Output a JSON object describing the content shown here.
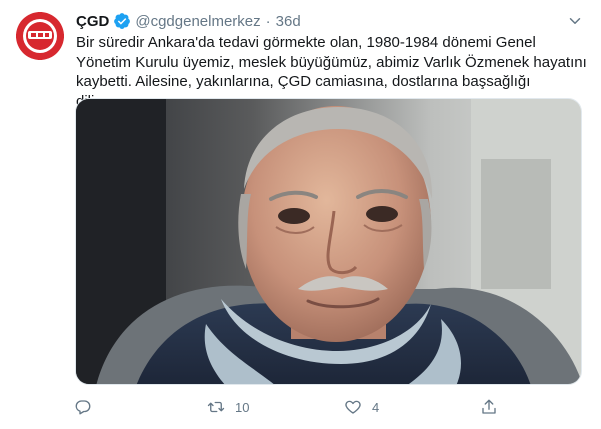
{
  "account": {
    "name": "ÇGD",
    "handle": "@cgdgenelmerkez",
    "separator": "·",
    "time": "36d",
    "avatar_icon": "cgd-logo-icon",
    "verified_icon": "verified-badge-icon"
  },
  "tweet": {
    "text": "Bir süredir Ankara'da tedavi görmekte olan, 1980-1984 dönemi Genel Yönetim Kurulu üyemiz, meslek büyüğümüz, abimiz Varlık Özmenek hayatını kaybetti. Ailesine, yakınlarına, ÇGD camiasına, dostlarına başsağlığı diliyoruz."
  },
  "actions": {
    "reply_count": "",
    "retweet_count": "10",
    "like_count": "4",
    "share_count": ""
  },
  "colors": {
    "text": "#14171a",
    "secondary": "#657786",
    "verified": "#1da1f2",
    "logo_red": "#d7282f"
  }
}
